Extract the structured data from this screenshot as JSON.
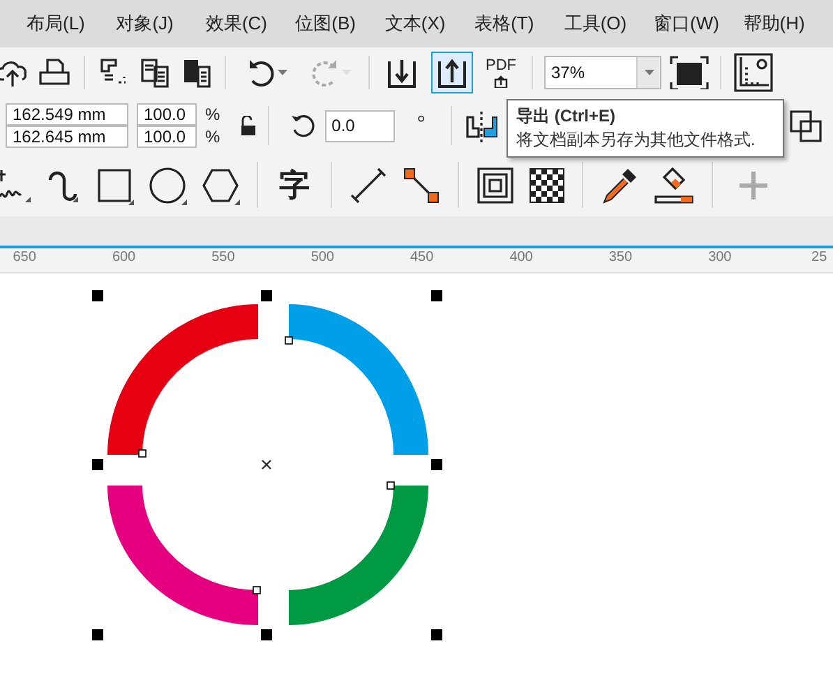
{
  "menu": [
    {
      "label": "布局(L)"
    },
    {
      "label": "对象(J)"
    },
    {
      "label": "效果(C)"
    },
    {
      "label": "位图(B)"
    },
    {
      "label": "文本(X)"
    },
    {
      "label": "表格(T)"
    },
    {
      "label": "工具(O)"
    },
    {
      "label": "窗口(W)"
    },
    {
      "label": "帮助(H)"
    }
  ],
  "toolbar": {
    "history": [
      {
        "disabled": false
      },
      {
        "disabled": true
      }
    ],
    "transfer": [
      {
        "selected": false
      },
      {
        "selected": true
      }
    ],
    "pdf_label": "PDF",
    "zoom": {
      "value": "37%"
    }
  },
  "property_bar": {
    "size_fields": [
      {
        "value": "162.549 mm"
      },
      {
        "value": "162.645 mm"
      }
    ],
    "scale_fields": [
      {
        "value": "100.0",
        "unit": "%"
      },
      {
        "value": "100.0",
        "unit": "%"
      }
    ],
    "rotation": {
      "value": "0.0",
      "unit": "°"
    }
  },
  "toolbox": {
    "text_tool": "字",
    "add_button": {
      "disabled": true
    }
  },
  "tooltip": {
    "title": "导出 (Ctrl+E)",
    "description": "将文档副本另存为其他文件格式."
  },
  "ruler": {
    "labels": [
      "650",
      "600",
      "550",
      "500",
      "450",
      "400",
      "350",
      "300",
      "25"
    ]
  },
  "shapes": [
    {
      "color": "#e60012"
    },
    {
      "color": "#00a0e9"
    },
    {
      "color": "#e4007f"
    },
    {
      "color": "#009944"
    }
  ]
}
